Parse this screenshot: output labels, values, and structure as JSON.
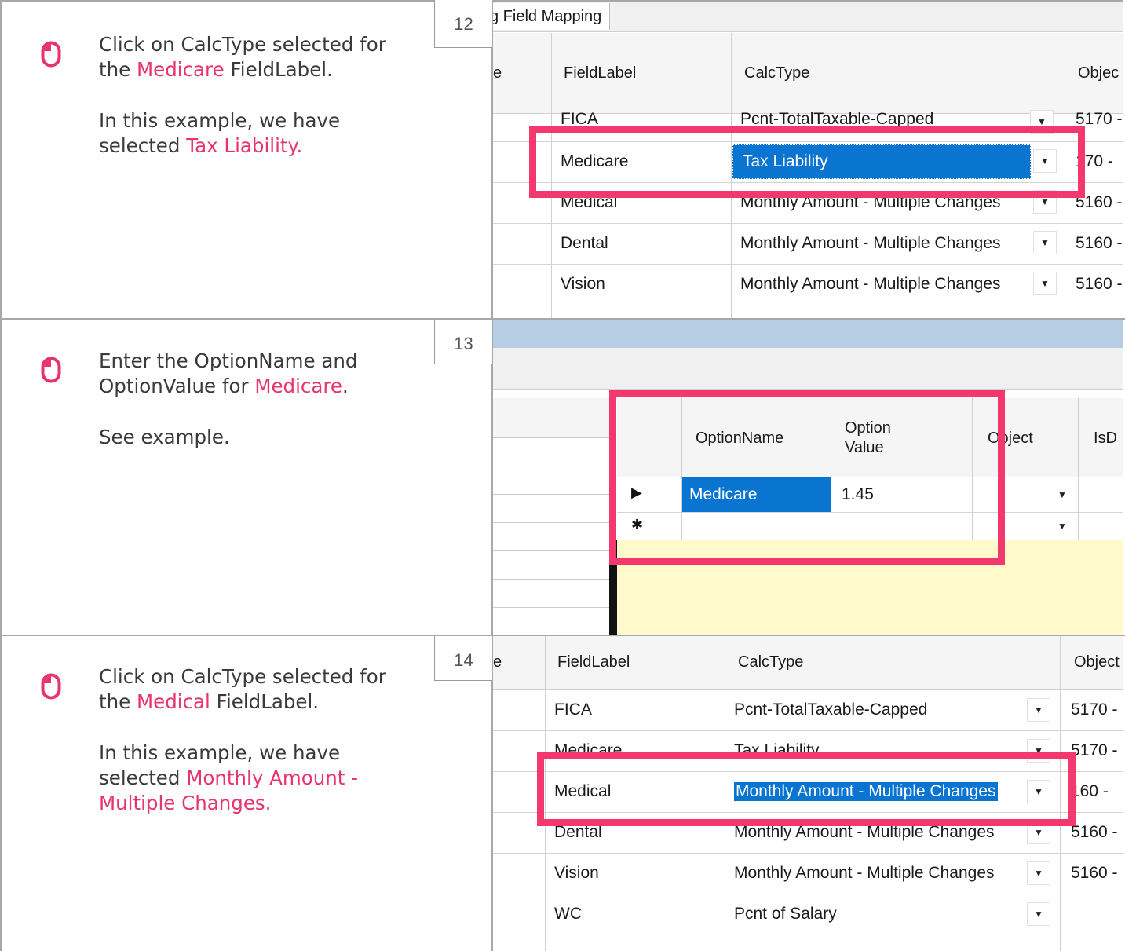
{
  "colors": {
    "accent": "#e8336d",
    "highlight_box": "#f2386d",
    "selection": "#0a74d1",
    "note_bg": "#fff9cc",
    "header_band": "#b7cde4"
  },
  "steps": [
    {
      "number": "12",
      "icon": "mouse-icon",
      "line1_a": "Click on CalcType selected for",
      "line2_a": "the ",
      "line2_hl": "Medicare",
      "line2_b": " FieldLabel.",
      "para2_a": "In this example, we have",
      "para2_b": "selected ",
      "para2_hl": "Tax Liability."
    },
    {
      "number": "13",
      "icon": "mouse-icon",
      "line1_a": "Enter the OptionName and",
      "line2_a": "OptionValue for ",
      "line2_hl": "Medicare",
      "line2_b": ".",
      "para2_a": "See example."
    },
    {
      "number": "14",
      "icon": "mouse-icon",
      "line1_a": "Click on CalcType selected for",
      "line2_a": "the ",
      "line2_hl": "Medical",
      "line2_b": " FieldLabel.",
      "para2_a": "In this example, we have",
      "para2_b": "selected ",
      "para2_hl": "Monthly Amount -",
      "para2_hl2": "Multiple Changes."
    }
  ],
  "grid1": {
    "tab": "g Field Mapping",
    "header_stub": "e",
    "headers": [
      "FieldLabel",
      "CalcType",
      "Objec"
    ],
    "rows": [
      {
        "label": "FICA",
        "calc": "Pcnt-TotalTaxable-Capped",
        "obj": "5170 -"
      },
      {
        "label": "Medicare",
        "calc": "Tax Liability",
        "obj": "170 -"
      },
      {
        "label": "Medical",
        "calc": "Monthly Amount - Multiple Changes",
        "obj": "5160 -"
      },
      {
        "label": "Dental",
        "calc": "Monthly Amount - Multiple Changes",
        "obj": "5160 -"
      },
      {
        "label": "Vision",
        "calc": "Monthly Amount - Multiple Changes",
        "obj": "5160 -"
      }
    ]
  },
  "grid2": {
    "headers": [
      "OptionName",
      "Option Value",
      "Object",
      "IsD"
    ],
    "rows": [
      {
        "indicator": "▶",
        "name": "Medicare",
        "value": "1.45"
      },
      {
        "indicator": "✱",
        "name": "",
        "value": ""
      }
    ]
  },
  "grid3": {
    "header_stub": "e",
    "headers": [
      "FieldLabel",
      "CalcType",
      "Object"
    ],
    "rows": [
      {
        "label": "FICA",
        "calc": "Pcnt-TotalTaxable-Capped",
        "obj": "5170 -"
      },
      {
        "label": "Medicare",
        "calc": "Tax Liability",
        "obj": "5170 -"
      },
      {
        "label": "Medical",
        "calc": "Monthly Amount - Multiple Changes",
        "obj": "160 -"
      },
      {
        "label": "Dental",
        "calc": "Monthly Amount - Multiple Changes",
        "obj": "5160 -"
      },
      {
        "label": "Vision",
        "calc": "Monthly Amount - Multiple Changes",
        "obj": "5160 -"
      },
      {
        "label": "WC",
        "calc": "Pcnt of Salary",
        "obj": ""
      }
    ]
  }
}
